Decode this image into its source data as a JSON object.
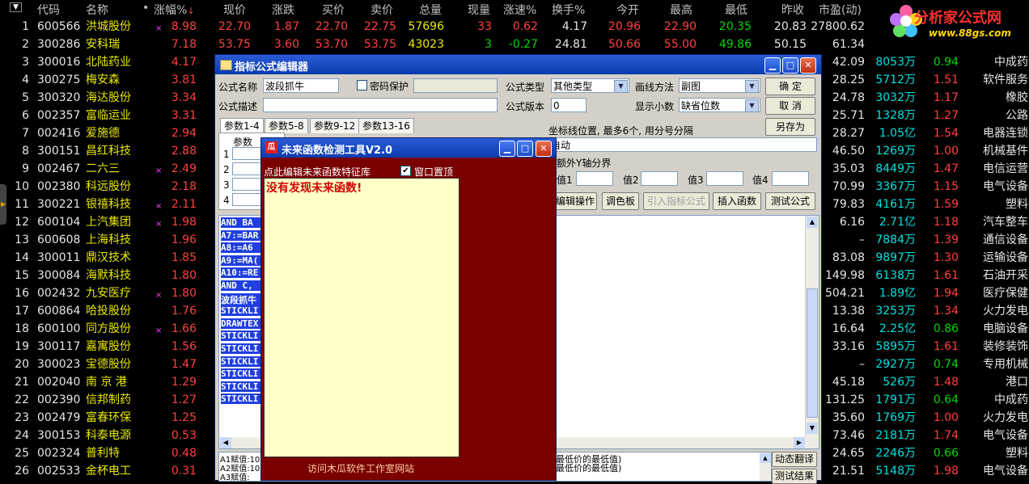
{
  "table": {
    "headers": [
      "代码",
      "名称",
      "•",
      "涨幅%",
      "现价",
      "涨跌",
      "买价",
      "卖价",
      "总量",
      "现量",
      "涨速%",
      "换手%",
      "今开",
      "最高",
      "最低",
      "昨收",
      "市盈(动)"
    ],
    "rows": [
      {
        "n": "1",
        "code": "600566",
        "name": "洪城股份",
        "mark": "×",
        "chg": "8.98",
        "price": "22.70",
        "diff": "1.87",
        "bid": "22.70",
        "ask": "22.75",
        "vol": "57696",
        "cur": "33",
        "spd": "0.62",
        "turn": "4.17",
        "open": "20.96",
        "high": "22.90",
        "low": "20.35",
        "prev": "20.83",
        "pe": "27800.62"
      },
      {
        "n": "2",
        "code": "300286",
        "name": "安科瑞",
        "mark": "",
        "chg": "7.18",
        "price": "53.75",
        "diff": "3.60",
        "bid": "53.70",
        "ask": "53.75",
        "vol": "43023",
        "cur": "3",
        "spd": "-0.27",
        "turn": "24.81",
        "open": "50.66",
        "high": "55.00",
        "low": "49.86",
        "prev": "50.15",
        "pe": "61.34",
        "cap": "",
        "ind": ""
      },
      {
        "n": "3",
        "code": "300016",
        "name": "北陆药业",
        "mark": "",
        "chg": "4.17",
        "pe": "42.09",
        "cap": "8053万",
        "r": "0.94",
        "ind": "中成药"
      },
      {
        "n": "4",
        "code": "300275",
        "name": "梅安森",
        "mark": "",
        "chg": "3.81",
        "pe": "28.25",
        "cap": "5712万",
        "r": "1.51",
        "ind": "软件服务"
      },
      {
        "n": "5",
        "code": "300320",
        "name": "海达股份",
        "mark": "",
        "chg": "3.34",
        "pe": "24.78",
        "cap": "3032万",
        "r": "1.17",
        "ind": "橡胶"
      },
      {
        "n": "6",
        "code": "002357",
        "name": "富临运业",
        "mark": "",
        "chg": "3.31",
        "pe": "25.71",
        "cap": "1328万",
        "r": "1.27",
        "ind": "公路"
      },
      {
        "n": "7",
        "code": "002416",
        "name": "爱施德",
        "mark": "",
        "chg": "2.94",
        "pe": "28.27",
        "cap": "1.05亿",
        "r": "1.54",
        "ind": "电器连锁"
      },
      {
        "n": "8",
        "code": "300151",
        "name": "昌红科技",
        "mark": "",
        "chg": "2.88",
        "pe": "46.50",
        "cap": "1269万",
        "r": "1.00",
        "ind": "机械基件"
      },
      {
        "n": "9",
        "code": "002467",
        "name": "二六三",
        "mark": "×",
        "chg": "2.49",
        "pe": "35.03",
        "cap": "8449万",
        "r": "1.47",
        "ind": "电信运营"
      },
      {
        "n": "10",
        "code": "002380",
        "name": "科远股份",
        "mark": "",
        "chg": "2.18",
        "pe": "70.99",
        "cap": "3367万",
        "r": "1.15",
        "ind": "电气设备"
      },
      {
        "n": "11",
        "code": "300221",
        "name": "银禧科技",
        "mark": "×",
        "chg": "2.11",
        "pe": "79.83",
        "cap": "4161万",
        "r": "1.59",
        "ind": "塑料"
      },
      {
        "n": "12",
        "code": "600104",
        "name": "上汽集团",
        "mark": "×",
        "chg": "1.98",
        "pe": "6.16",
        "cap": "2.71亿",
        "r": "1.18",
        "ind": "汽车整车"
      },
      {
        "n": "13",
        "code": "600608",
        "name": "上海科技",
        "mark": "",
        "chg": "1.96",
        "pe": "–",
        "cap": "7884万",
        "r": "1.39",
        "ind": "通信设备"
      },
      {
        "n": "14",
        "code": "300011",
        "name": "鼎汉技术",
        "mark": "",
        "chg": "1.85",
        "pe": "83.08",
        "cap": "9897万",
        "r": "1.30",
        "ind": "运输设备"
      },
      {
        "n": "15",
        "code": "300084",
        "name": "海默科技",
        "mark": "",
        "chg": "1.80",
        "pe": "149.98",
        "cap": "6138万",
        "r": "1.61",
        "ind": "石油开采"
      },
      {
        "n": "16",
        "code": "002432",
        "name": "九安医疗",
        "mark": "×",
        "chg": "1.80",
        "pe": "504.21",
        "cap": "1.89亿",
        "r": "1.94",
        "ind": "医疗保健"
      },
      {
        "n": "17",
        "code": "600864",
        "name": "哈投股份",
        "mark": "",
        "chg": "1.76",
        "pe": "13.38",
        "cap": "3253万",
        "r": "1.34",
        "ind": "火力发电"
      },
      {
        "n": "18",
        "code": "600100",
        "name": "同方股份",
        "mark": "×",
        "chg": "1.66",
        "pe": "16.64",
        "cap": "2.25亿",
        "r": "0.86",
        "ind": "电脑设备"
      },
      {
        "n": "19",
        "code": "300117",
        "name": "嘉寓股份",
        "mark": "",
        "chg": "1.56",
        "pe": "33.16",
        "cap": "5895万",
        "r": "1.61",
        "ind": "装修装饰"
      },
      {
        "n": "20",
        "code": "300023",
        "name": "宝德股份",
        "mark": "",
        "chg": "1.47",
        "pe": "–",
        "cap": "2927万",
        "r": "0.74",
        "ind": "专用机械"
      },
      {
        "n": "21",
        "code": "002040",
        "name": "南 京 港",
        "mark": "",
        "chg": "1.29",
        "pe": "45.18",
        "cap": "526万",
        "r": "1.48",
        "ind": "港口"
      },
      {
        "n": "22",
        "code": "002390",
        "name": "信邦制药",
        "mark": "",
        "chg": "1.27",
        "pe": "131.25",
        "cap": "1791万",
        "r": "0.64",
        "ind": "中成药"
      },
      {
        "n": "23",
        "code": "002479",
        "name": "富春环保",
        "mark": "",
        "chg": "1.25",
        "pe": "35.60",
        "cap": "1769万",
        "r": "1.00",
        "ind": "火力发电"
      },
      {
        "n": "24",
        "code": "300153",
        "name": "科泰电源",
        "mark": "",
        "chg": "0.53",
        "pe": "73.46",
        "cap": "2181万",
        "r": "1.74",
        "ind": "电气设备"
      },
      {
        "n": "25",
        "code": "002324",
        "name": "普利特",
        "mark": "",
        "chg": "0.48",
        "pe": "24.65",
        "cap": "2246万",
        "r": "0.66",
        "ind": "塑料"
      },
      {
        "n": "26",
        "code": "002533",
        "name": "金杯电工",
        "mark": "",
        "chg": "0.31",
        "pe": "21.51",
        "cap": "5148万",
        "r": "1.98",
        "ind": "电气设备"
      }
    ]
  },
  "logo": {
    "name": "分析家公式网",
    "url": "www.88gs.com"
  },
  "editor": {
    "title": "指标公式编辑器",
    "name_label": "公式名称",
    "name_value": "波段抓牛",
    "pwd_label": "密码保护",
    "desc_label": "公式描述",
    "type_label": "公式类型",
    "type_value": "其他类型",
    "draw_label": "画线方法",
    "draw_value": "副图",
    "ver_label": "公式版本",
    "ver_value": "0",
    "dec_label": "显示小数",
    "dec_value": "缺省位数",
    "ok": "确 定",
    "cancel": "取 消",
    "saveas": "另存为",
    "tabs": [
      "参数1-4",
      "参数5-8",
      "参数9-12",
      "参数13-16"
    ],
    "param_header": "参数",
    "param_rows": [
      "1",
      "2",
      "3",
      "4"
    ],
    "axis_label": "坐标线位置, 最多6个, 用分号分隔",
    "axis_value": "自动",
    "yaxis_label": "额外Y轴分界",
    "val_labels": [
      "值1",
      "值2",
      "值3",
      "值4"
    ],
    "actions": [
      "编辑操作",
      "调色板",
      "引入指标公式",
      "插入函数",
      "测试公式"
    ],
    "code_lines": [
      "AND BA",
      "A7:=BAR",
      "A8:=A6",
      "A9:=MA(",
      "A10:=RE",
      "AND C,",
      "波段抓牛",
      "STICKLI",
      "DRAWTEX",
      "STICKLI",
      "STICKLI",
      "STICKLI",
      "STICKLI",
      "STICKLI",
      "STICKLI"
    ],
    "bottom_lines": [
      "A1赋值:10",
      "A2赋值:10",
      "A3赋值:"
    ],
    "bottom_right_lines": [
      "最低价的最低值)",
      "最低价的最低值)"
    ],
    "dyn_translate": "动态翻译",
    "test_result": "测试结果"
  },
  "tool": {
    "title": "未来函数检测工具V2.0",
    "edit_link": "点此编辑未来函数特征库",
    "topmost_label": "窗口置顶",
    "topmost_checked": true,
    "result": "没有发现未来函数!",
    "visit_link": "访问木瓜软件工作室网站"
  },
  "colors": {
    "up": "#ff4040",
    "down": "#00d800",
    "tool_bg": "#7a0000",
    "note_bg": "#ffffc8"
  }
}
